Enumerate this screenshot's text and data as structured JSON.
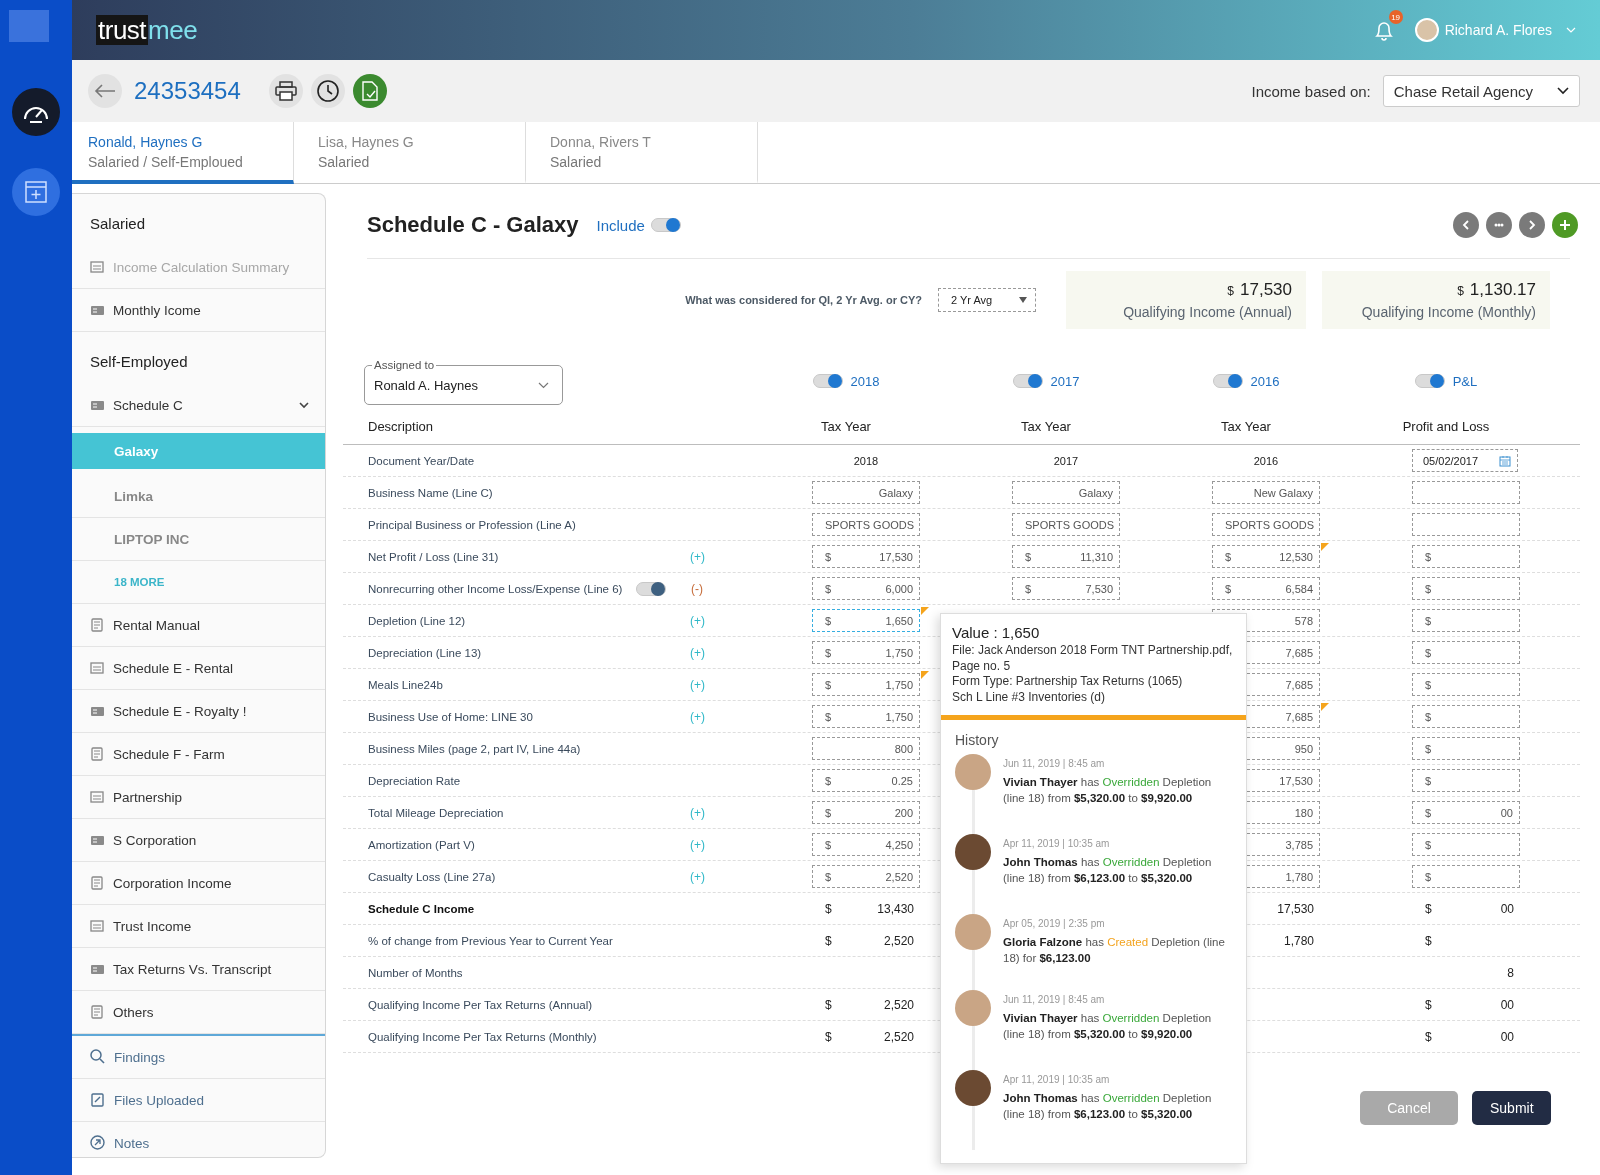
{
  "header": {
    "logo": {
      "part_1": "trust",
      "part_2": "mee"
    },
    "notifications": {
      "count": "19"
    },
    "user": {
      "name": "Richard A. Flores"
    }
  },
  "toolbar": {
    "loan_number": "24353454",
    "income_label": "Income based on:",
    "income_source": "Chase Retail Agency"
  },
  "borrower_tabs": [
    {
      "name": "Ronald, Haynes G",
      "type": "Salaried / Self-Emploued",
      "selected": true
    },
    {
      "name": "Lisa, Haynes G",
      "type": "Salaried",
      "selected": false
    },
    {
      "name": "Donna, Rivers T",
      "type": "Salaried",
      "selected": false
    }
  ],
  "sidebar": {
    "sections": [
      {
        "heading": "Salaried",
        "items": [
          {
            "label": "Income Calculation Summary",
            "disabled": true,
            "selected": false
          },
          {
            "label": "Monthly Icome",
            "disabled": false,
            "selected": false
          }
        ]
      },
      {
        "heading": "Self-Employed",
        "items": [
          {
            "label": "Schedule C",
            "disabled": false,
            "selected": false,
            "expanded": true,
            "children": [
              {
                "label": "Galaxy",
                "kind": "entry",
                "selected": true
              },
              {
                "label": "Limka",
                "kind": "entry",
                "selected": false
              },
              {
                "label": "LIPTOP INC",
                "kind": "entry",
                "selected": false
              },
              {
                "label": "18 MORE",
                "kind": "more",
                "selected": false
              }
            ]
          },
          {
            "label": "Rental Manual",
            "disabled": false,
            "selected": false
          },
          {
            "label": "Schedule E - Rental",
            "disabled": false,
            "selected": false
          },
          {
            "label": "Schedule E - Royalty !",
            "disabled": false,
            "selected": false
          },
          {
            "label": "Schedule F - Farm",
            "disabled": false,
            "selected": false
          },
          {
            "label": "Partnership",
            "disabled": false,
            "selected": false
          },
          {
            "label": "S Corporation",
            "disabled": false,
            "selected": false
          },
          {
            "label": "Corporation Income",
            "disabled": false,
            "selected": false
          },
          {
            "label": "Trust Income",
            "disabled": false,
            "selected": false
          },
          {
            "label": "Tax Returns Vs. Transcript",
            "disabled": false,
            "selected": false
          },
          {
            "label": "Others",
            "disabled": false,
            "selected": false
          }
        ]
      },
      {
        "items": [
          {
            "label": "Findings",
            "disabled": false,
            "selected": false
          },
          {
            "label": "Files Uploaded",
            "disabled": false,
            "selected": false
          },
          {
            "label": "Notes",
            "disabled": false,
            "selected": false
          }
        ]
      }
    ]
  },
  "form": {
    "title": "Schedule C - Galaxy",
    "include": {
      "label": "Include",
      "on": true
    },
    "qi_question": {
      "label": "What was considered for QI, 2 Yr Avg. or CY?",
      "value": "2 Yr Avg"
    },
    "summary": [
      {
        "currency": "$",
        "amount": "17,530",
        "label": "Qualifying Income (Annual)"
      },
      {
        "currency": "$",
        "amount": "1,130.17",
        "label": "Qualifying Income (Monthly)"
      }
    ],
    "assigned_to": {
      "label": "Assigned to",
      "value": "Ronald A. Haynes"
    },
    "column_toggles": [
      {
        "label": "2018",
        "on": true
      },
      {
        "label": "2017",
        "on": true
      },
      {
        "label": "2016",
        "on": true
      },
      {
        "label": "P&L",
        "on": true
      }
    ],
    "description_header": "Description",
    "columns": [
      "Tax Year",
      "Tax Year",
      "Tax Year",
      "Profit and Loss"
    ],
    "rows": [
      {
        "label": "Document Year/Date",
        "bold": false,
        "cells": [
          {
            "kind": "text",
            "value": "2018"
          },
          {
            "kind": "text",
            "value": "2017"
          },
          {
            "kind": "text",
            "value": "2016"
          },
          {
            "kind": "date",
            "value": "05/02/2017"
          }
        ]
      },
      {
        "label": "Business Name (Line C)",
        "bold": false,
        "cells": [
          {
            "kind": "field",
            "value": "Galaxy",
            "flagged": false,
            "active": false
          },
          {
            "kind": "field",
            "value": "Galaxy",
            "flagged": false,
            "active": false
          },
          {
            "kind": "field",
            "value": "New Galaxy",
            "flagged": false,
            "active": false
          },
          {
            "kind": "field",
            "flagged": false,
            "active": false
          }
        ]
      },
      {
        "label": "Principal Business or Profession (Line A)",
        "bold": false,
        "cells": [
          {
            "kind": "field",
            "value": "SPORTS GOODS",
            "flagged": false,
            "active": false
          },
          {
            "kind": "field",
            "value": "SPORTS GOODS",
            "flagged": false,
            "active": false
          },
          {
            "kind": "field",
            "value": "SPORTS GOODS",
            "flagged": false,
            "active": false
          },
          {
            "kind": "field",
            "flagged": false,
            "active": false
          }
        ]
      },
      {
        "label": "Net Profit / Loss (Line 31)",
        "bold": false,
        "sign": {
          "text": "(+)",
          "kind": "add"
        },
        "cells": [
          {
            "kind": "field",
            "currency": "$",
            "value": "17,530",
            "flagged": false,
            "active": false
          },
          {
            "kind": "field",
            "currency": "$",
            "value": "11,310",
            "flagged": false,
            "active": false
          },
          {
            "kind": "field",
            "currency": "$",
            "value": "12,530",
            "flagged": true,
            "active": false
          },
          {
            "kind": "field",
            "currency": "$",
            "flagged": false,
            "active": false
          }
        ]
      },
      {
        "label": "Nonrecurring other Income Loss/Expense (Line 6)",
        "bold": false,
        "toggle": {
          "on": true
        },
        "sign": {
          "text": "(-)",
          "kind": "subtract"
        },
        "cells": [
          {
            "kind": "field",
            "currency": "$",
            "value": "6,000",
            "flagged": false,
            "active": false
          },
          {
            "kind": "field",
            "currency": "$",
            "value": "7,530",
            "flagged": false,
            "active": false
          },
          {
            "kind": "field",
            "currency": "$",
            "value": "6,584",
            "flagged": false,
            "active": false
          },
          {
            "kind": "field",
            "currency": "$",
            "flagged": false,
            "active": false
          }
        ]
      },
      {
        "label": "Depletion (Line 12)",
        "bold": false,
        "sign": {
          "text": "(+)",
          "kind": "add"
        },
        "cells": [
          {
            "kind": "field",
            "currency": "$",
            "value": "1,650",
            "flagged": true,
            "active": true
          },
          null,
          {
            "kind": "field",
            "value": "578",
            "flagged": false,
            "active": false
          },
          {
            "kind": "field",
            "currency": "$",
            "flagged": false,
            "active": false
          }
        ]
      },
      {
        "label": "Depreciation (Line 13)",
        "bold": false,
        "sign": {
          "text": "(+)",
          "kind": "add"
        },
        "cells": [
          {
            "kind": "field",
            "currency": "$",
            "value": "1,750",
            "flagged": false,
            "active": false
          },
          null,
          {
            "kind": "field",
            "value": "7,685",
            "flagged": false,
            "active": false
          },
          {
            "kind": "field",
            "currency": "$",
            "flagged": false,
            "active": false
          }
        ]
      },
      {
        "label": "Meals Line24b",
        "bold": false,
        "sign": {
          "text": "(+)",
          "kind": "add"
        },
        "cells": [
          {
            "kind": "field",
            "currency": "$",
            "value": "1,750",
            "flagged": true,
            "active": false
          },
          null,
          {
            "kind": "field",
            "value": "7,685",
            "flagged": false,
            "active": false
          },
          {
            "kind": "field",
            "currency": "$",
            "flagged": false,
            "active": false
          }
        ]
      },
      {
        "label": "Business Use of Home: LINE 30",
        "bold": false,
        "sign": {
          "text": "(+)",
          "kind": "add"
        },
        "cells": [
          {
            "kind": "field",
            "currency": "$",
            "value": "1,750",
            "flagged": false,
            "active": false
          },
          null,
          {
            "kind": "field",
            "value": "7,685",
            "flagged": true,
            "active": false
          },
          {
            "kind": "field",
            "currency": "$",
            "flagged": false,
            "active": false
          }
        ]
      },
      {
        "label": "Business Miles (page 2, part IV, Line 44a)",
        "bold": false,
        "cells": [
          {
            "kind": "field",
            "value": "800",
            "flagged": false,
            "active": false
          },
          null,
          {
            "kind": "field",
            "value": "950",
            "flagged": false,
            "active": false
          },
          {
            "kind": "field",
            "currency": "$",
            "flagged": false,
            "active": false
          }
        ]
      },
      {
        "label": "Depreciation Rate",
        "bold": false,
        "cells": [
          {
            "kind": "field",
            "currency": "$",
            "value": "0.25",
            "flagged": false,
            "active": false
          },
          null,
          {
            "kind": "field",
            "value": "17,530",
            "flagged": false,
            "active": false
          },
          {
            "kind": "field",
            "currency": "$",
            "flagged": false,
            "active": false
          }
        ]
      },
      {
        "label": "Total Mileage Depreciation",
        "bold": false,
        "sign": {
          "text": "(+)",
          "kind": "add"
        },
        "cells": [
          {
            "kind": "field",
            "currency": "$",
            "value": "200",
            "flagged": false,
            "active": false
          },
          null,
          {
            "kind": "field",
            "value": "180",
            "flagged": false,
            "active": false
          },
          {
            "kind": "field",
            "currency": "$",
            "value": "00",
            "flagged": false,
            "active": false
          }
        ]
      },
      {
        "label": "Amortization (Part V)",
        "bold": false,
        "sign": {
          "text": "(+)",
          "kind": "add"
        },
        "cells": [
          {
            "kind": "field",
            "currency": "$",
            "value": "4,250",
            "flagged": false,
            "active": false
          },
          null,
          {
            "kind": "field",
            "value": "3,785",
            "flagged": false,
            "active": false
          },
          {
            "kind": "field",
            "currency": "$",
            "flagged": false,
            "active": false
          }
        ]
      },
      {
        "label": "Casualty Loss (Line 27a)",
        "bold": false,
        "sign": {
          "text": "(+)",
          "kind": "add"
        },
        "cells": [
          {
            "kind": "field",
            "currency": "$",
            "value": "2,520",
            "flagged": false,
            "active": false
          },
          null,
          {
            "kind": "field",
            "value": "1,780",
            "flagged": false,
            "active": false
          },
          {
            "kind": "field",
            "currency": "$",
            "flagged": false,
            "active": false
          }
        ]
      },
      {
        "label": "Schedule C Income",
        "bold": true,
        "cells": [
          {
            "kind": "sum",
            "currency": "$",
            "value": "13,430"
          },
          null,
          {
            "kind": "sum",
            "value": "17,530"
          },
          {
            "kind": "sum",
            "currency": "$",
            "value": "00"
          }
        ]
      },
      {
        "label": "% of change from Previous Year to Current Year",
        "bold": false,
        "cells": [
          {
            "kind": "sum",
            "currency": "$",
            "value": "2,520"
          },
          null,
          {
            "kind": "sum",
            "value": "1,780"
          },
          {
            "kind": "sum",
            "currency": "$"
          }
        ]
      },
      {
        "label": "Number of Months",
        "bold": false,
        "cells": [
          null,
          null,
          null,
          {
            "kind": "sum",
            "value": "8"
          }
        ]
      },
      {
        "label": "Qualifying Income Per Tax Returns (Annual)",
        "bold": false,
        "cells": [
          {
            "kind": "sum",
            "currency": "$",
            "value": "2,520"
          },
          null,
          null,
          {
            "kind": "sum",
            "currency": "$",
            "value": "00"
          }
        ]
      },
      {
        "label": "Qualifying Income Per Tax Returns (Monthly)",
        "bold": false,
        "cells": [
          {
            "kind": "sum",
            "currency": "$",
            "value": "2,520"
          },
          null,
          null,
          {
            "kind": "sum",
            "currency": "$",
            "value": "00"
          }
        ]
      }
    ],
    "buttons": [
      {
        "label": "Cancel",
        "disabled": true
      },
      {
        "label": "Submit",
        "disabled": false
      }
    ]
  },
  "popover": {
    "value": "Value : 1,650",
    "details": [
      "File: Jack Anderson 2018 Form TNT Partnership.pdf, Page no. 5",
      "Form Type: Partnership Tax Returns (1065)",
      "Sch L Line #3 Inventories (d)"
    ],
    "history_title": "History",
    "history": [
      {
        "date": "Jun 11, 2019 | 8:45 am",
        "before": "**Vivian Thayer** has",
        "action": "Overridden",
        "kind": "override",
        "after": "Depletion (line 18) from **$5,320.00** to **$9,920.00**"
      },
      {
        "date": "Apr 11, 2019 | 10:35 am",
        "before": "**John Thomas** has",
        "action": "Overridden",
        "kind": "override",
        "after": "Depletion (line 18) from **$6,123.00** to **$5,320.00**"
      },
      {
        "date": "Apr 05, 2019 | 2:35 pm",
        "before": "**Gloria Falzone** has",
        "action": "Created",
        "kind": "create",
        "after": "Depletion (line 18)  for **$6,123.00**"
      },
      {
        "date": "Jun 11, 2019 | 8:45 am",
        "before": "**Vivian Thayer** has",
        "action": "Overridden",
        "kind": "override",
        "after": "Depletion (line 18) from **$5,320.00** to **$9,920.00**"
      },
      {
        "date": "Apr 11, 2019 | 10:35 am",
        "before": "**John Thomas** has",
        "action": "Overridden",
        "kind": "override",
        "after": "Depletion (line 18) from **$6,123.00** to **$5,320.00**"
      }
    ]
  }
}
